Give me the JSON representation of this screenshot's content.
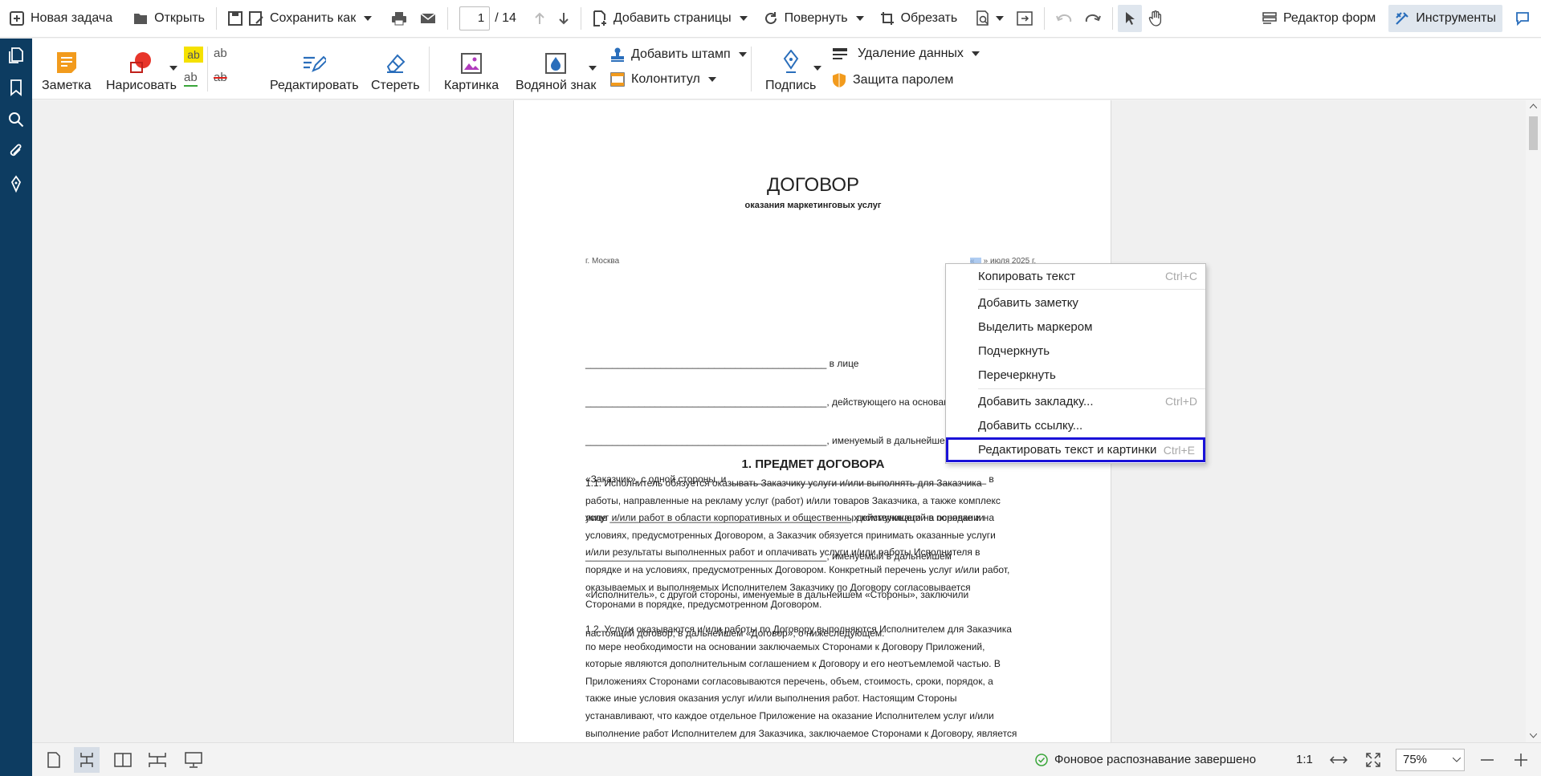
{
  "topbar": {
    "new_task": "Новая задача",
    "open": "Открыть",
    "save_as": "Сохранить как",
    "page_current": "1",
    "page_total": "/ 14",
    "add_pages": "Добавить страницы",
    "rotate": "Повернуть",
    "crop": "Обрезать",
    "form_editor": "Редактор форм",
    "tools": "Инструменты"
  },
  "ribbon": {
    "note": "Заметка",
    "draw": "Нарисовать",
    "edit": "Редактировать",
    "erase": "Стереть",
    "picture": "Картинка",
    "watermark": "Водяной знак",
    "add_stamp": "Добавить штамп",
    "header_footer": "Колонтитул",
    "signature": "Подпись",
    "remove_data": "Удаление данных",
    "password": "Защита паролем",
    "ab": "ab"
  },
  "document": {
    "title": "ДОГОВОР",
    "subtitle": "оказания маркетинговых услуг",
    "city": "г. Москва",
    "date": "«__» июля 2025 г.",
    "intro_lines": [
      "_____________________________________________ в лице",
      "_____________________________________________, действующего на основании",
      "_____________________________________________, именуемый в дальнейшем",
      "«Заказчик», с одной стороны, и ________________________________________________ в",
      "лице _____________________________________________, действующего на основании",
      "_____________________________________________, именуемый в дальнейшем",
      "«Исполнитель», с другой стороны, именуемые в дальнейшем «Стороны», заключили",
      "настоящий договор, в дальнейшем «Договор», о нижеследующем:"
    ],
    "section1": "1. ПРЕДМЕТ ДОГОВОРА",
    "p1_1": "1.1. Исполнитель обязуется оказывать Заказчику услуги и/или выполнять для Заказчика\nработы, направленные на рекламу услуг (работ) и/или товаров Заказчика, а также комплекс\nуслуг и/или работ в области корпоративных и общественных коммуникаций в порядке и на\nусловиях, предусмотренных Договором, а Заказчик обязуется принимать оказанные услуги\nи/или результаты выполненных работ и оплачивать услуги и/или работы Исполнителя в\nпорядке и на условиях, предусмотренных Договором. Конкретный перечень услуг и/или работ,\nоказываемых и выполняемых Исполнителем Заказчику по Договору согласовывается\nСторонами в порядке, предусмотренном Договором.",
    "p1_2": "1.2. Услуги оказываются и/или работы по Договору выполняются Исполнителем для Заказчика\nпо мере необходимости на основании заключаемых Сторонами к Договору Приложений,\nкоторые являются дополнительным соглашением к Договору и его неотъемлемой частью. В\nПриложениях Сторонами согласовываются перечень, объем, стоимость, сроки, порядок, а\nтакже иные условия оказания услуг и/или выполнения работ. Настоящим Стороны\nустанавливают, что каждое отдельное Приложение на оказание Исполнителем услуг и/или\nвыполнение работ Исполнителем для Заказчика, заключаемое Сторонами к Договору, является"
  },
  "context_menu": {
    "items": [
      {
        "label": "Копировать текст",
        "shortcut": "Ctrl+C"
      },
      {
        "label": "Добавить заметку",
        "shortcut": ""
      },
      {
        "label": "Выделить маркером",
        "shortcut": ""
      },
      {
        "label": "Подчеркнуть",
        "shortcut": ""
      },
      {
        "label": "Перечеркнуть",
        "shortcut": ""
      },
      {
        "label": "Добавить закладку...",
        "shortcut": "Ctrl+D"
      },
      {
        "label": "Добавить ссылку...",
        "shortcut": ""
      },
      {
        "label": "Редактировать текст и картинки",
        "shortcut": "Ctrl+E"
      }
    ]
  },
  "statusbar": {
    "recognition": "Фоновое распознавание завершено",
    "ratio": "1:1",
    "zoom": "75%"
  },
  "colors": {
    "sidebar": "#0d3c61",
    "accent_blue": "#2a6ebb",
    "highlight_border": "#1a12d8"
  }
}
